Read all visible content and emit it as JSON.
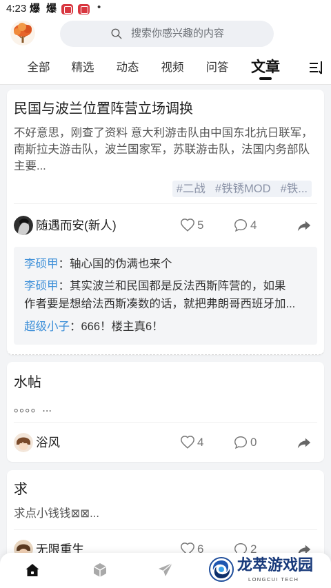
{
  "status_bar": {
    "time": "4:23",
    "notification_glyphs": [
      "爆",
      "爆"
    ],
    "app_icons": [
      "red-app-icon",
      "red-app-icon"
    ],
    "more_indicator": "•"
  },
  "header": {
    "avatar_icon": "tree-avatar-icon",
    "search": {
      "icon": "search-icon",
      "placeholder": "搜索你感兴趣的内容"
    }
  },
  "tabs": [
    {
      "label": "全部",
      "active": false
    },
    {
      "label": "精选",
      "active": false
    },
    {
      "label": "动态",
      "active": false
    },
    {
      "label": "视频",
      "active": false
    },
    {
      "label": "问答",
      "active": false
    },
    {
      "label": "文章",
      "active": true
    }
  ],
  "tabs_menu_icon": "sort-menu-icon",
  "icons": {
    "like": "heart-icon",
    "comment": "comment-bubble-icon",
    "share": "share-arrow-icon"
  },
  "comment_separator": "：",
  "posts": [
    {
      "title": "民国与波兰位置阵营立场调换",
      "excerpt": "不好意思，刚查了资料 意大利游击队由中国东北抗日联军，南斯拉夫游击队，波兰国家军，苏联游击队，法国内务部队主要...",
      "tags": [
        "#二战",
        "#铁锈MOD",
        "#铁..."
      ],
      "author": "随遇而安(新人)",
      "likes": 5,
      "comment_count": 4,
      "comments": [
        {
          "user": "李硕甲",
          "text": "轴心国的伪满也来个"
        },
        {
          "user": "李硕甲",
          "text": "其实波兰和民国都是反法西斯阵营的，如果作者要是想给法西斯凑数的话，就把弗朗哥西班牙加..."
        },
        {
          "user": "超级小子",
          "text": "666！楼主真6！"
        }
      ]
    },
    {
      "title": "水帖",
      "excerpt": "。。。。...",
      "author": "浴风",
      "likes": 4,
      "comment_count": 0
    },
    {
      "title": "求",
      "excerpt": "求点小钱钱⊠⊠...",
      "author": "无限重生",
      "likes": 6,
      "comment_count": 2
    }
  ],
  "bottom_nav": {
    "items": [
      {
        "icon": "home-icon",
        "active": true
      },
      {
        "icon": "cube-icon",
        "active": false
      },
      {
        "icon": "paper-plane-icon",
        "active": false
      }
    ]
  },
  "watermark": {
    "name": "龙萃游戏园",
    "tagline": "LONGCUI TECH"
  },
  "colors": {
    "accent": "#3d8fd8",
    "active_tab": "#111111",
    "background": "#f3f4f6"
  }
}
